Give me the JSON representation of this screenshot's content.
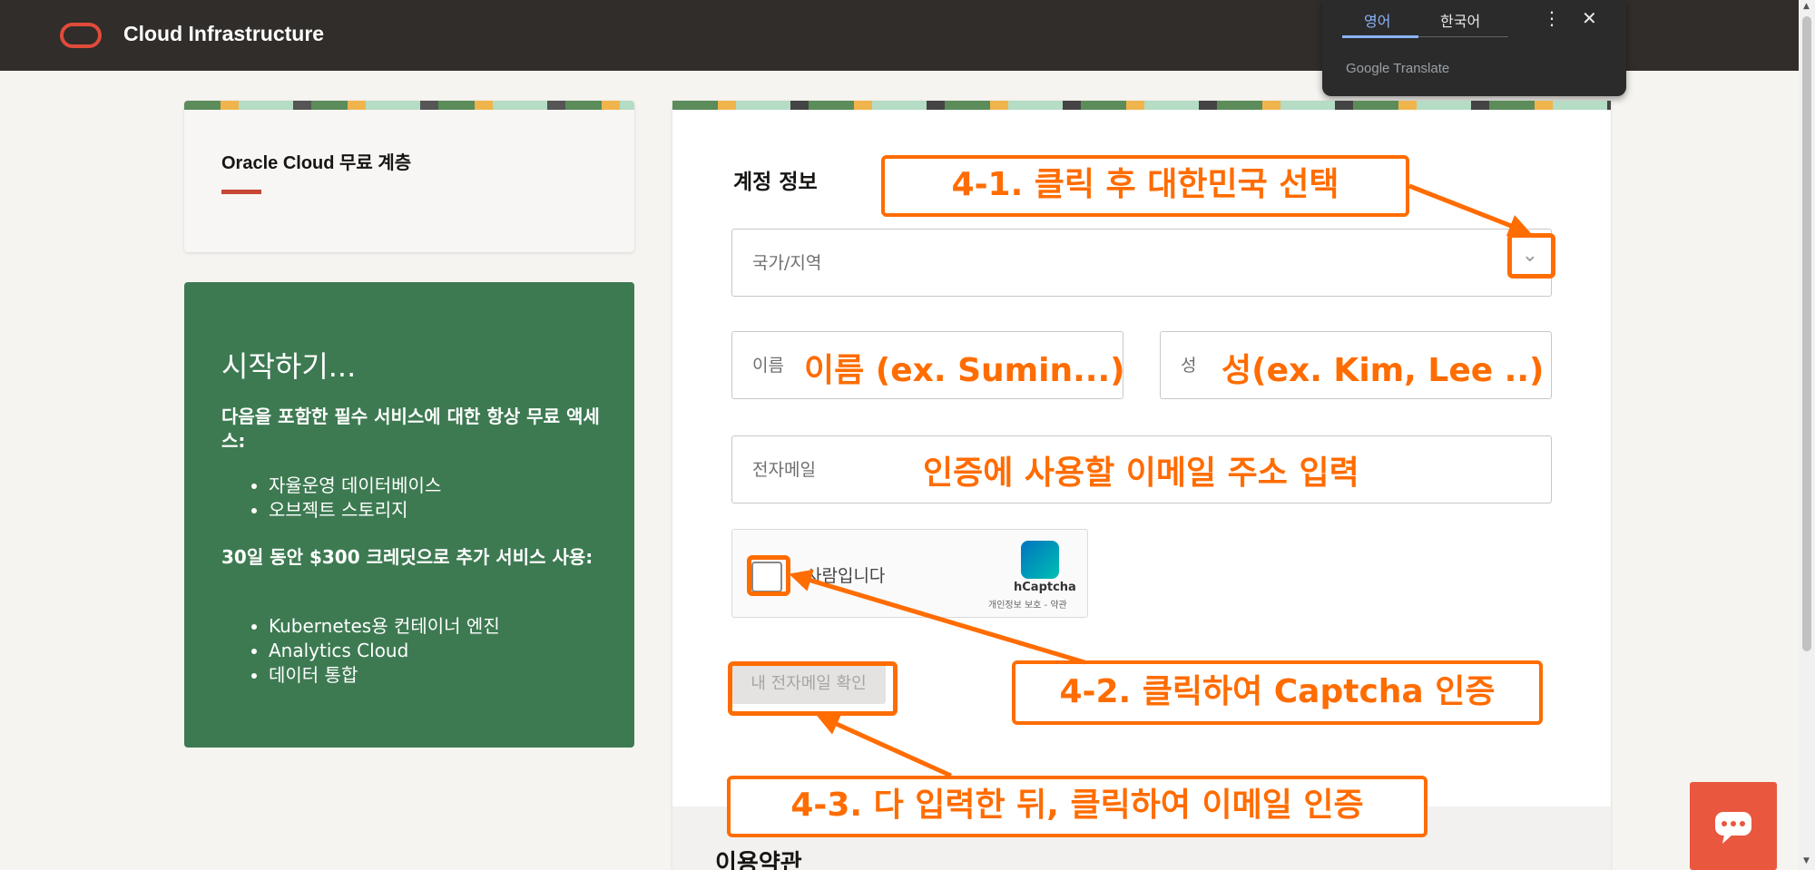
{
  "header": {
    "brand": "Cloud Infrastructure"
  },
  "translate": {
    "tab_source": "영어",
    "tab_target": "한국어",
    "more": "⋮",
    "close": "✕",
    "footer": "Google Translate"
  },
  "promo": {
    "title": "Oracle Cloud 무료 계층"
  },
  "getting_started": {
    "heading": "시작하기...",
    "always_free": "다음을 포함한 필수 서비스에 대한 항상 무료 액세스:",
    "always_free_items": [
      "자율운영 데이터베이스",
      "오브젝트 스토리지"
    ],
    "credit": "30일 동안 $300 크레딧으로 추가 서비스 사용:",
    "credit_items": [
      "Kubernetes용 컨테이너 엔진",
      "Analytics Cloud",
      "데이터 통합"
    ]
  },
  "form": {
    "section_title": "계정 정보",
    "country_label": "국가/지역",
    "first_name_label": "이름",
    "last_name_label": "성",
    "email_label": "전자메일",
    "captcha_text": "사람입니다",
    "captcha_brand": "hCaptcha",
    "captcha_links": "개인정보 보호 - 약관",
    "verify_button": "내 전자메일 확인",
    "footer_text": "이용약관"
  },
  "annotations": {
    "country": "4-1. 클릭 후 대한민국 선택",
    "first_name": "이름 (ex. Sumin...)",
    "last_name": "성(ex. Kim, Lee ..)",
    "email": "인증에 사용할 이메일 주소 입력",
    "captcha": "4-2. 클릭하여 Captcha 인증",
    "verify": "4-3. 다 입력한 뒤, 클릭하여 이메일 인증",
    "color": "#ff6c00"
  },
  "icons": {
    "chevron": "chevron-down-icon",
    "chat": "chat-icon"
  }
}
